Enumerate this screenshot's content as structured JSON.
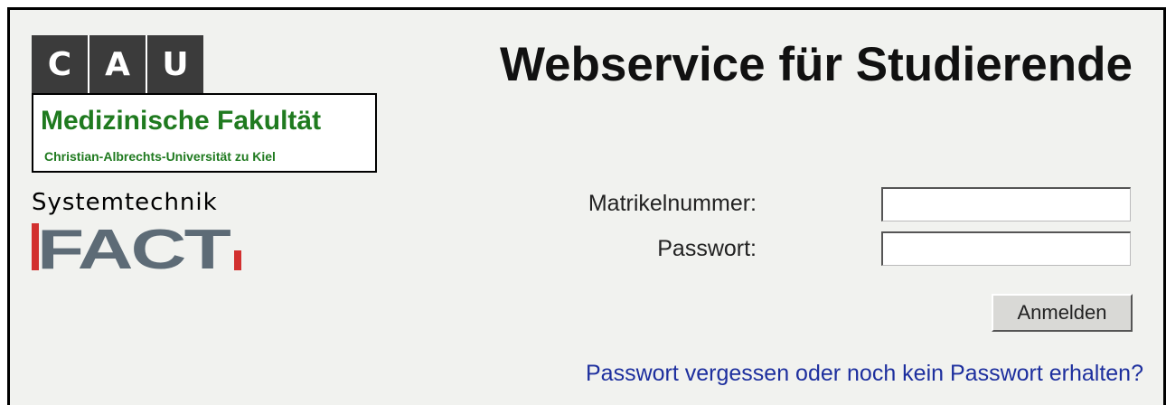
{
  "logo": {
    "letters": [
      "C",
      "A",
      "U"
    ],
    "faculty": "Medizinische Fakultät",
    "university": "Christian-Albrechts-Universität zu Kiel",
    "systemtechnik": "Systemtechnik",
    "fact_text": "FACT"
  },
  "header": {
    "title": "Webservice für Studierende"
  },
  "form": {
    "matrikel_label": "Matrikelnummer:",
    "matrikel_value": "",
    "password_label": "Passwort:",
    "password_value": "",
    "submit_label": "Anmelden"
  },
  "links": {
    "forgot_password": "Passwort vergessen oder noch kein Passwort erhalten?"
  },
  "colors": {
    "background": "#f1f2ef",
    "faculty_green": "#1f7a1f",
    "link_blue": "#1d2f9e",
    "fact_gray": "#5d6b76",
    "fact_red": "#d2302f"
  }
}
